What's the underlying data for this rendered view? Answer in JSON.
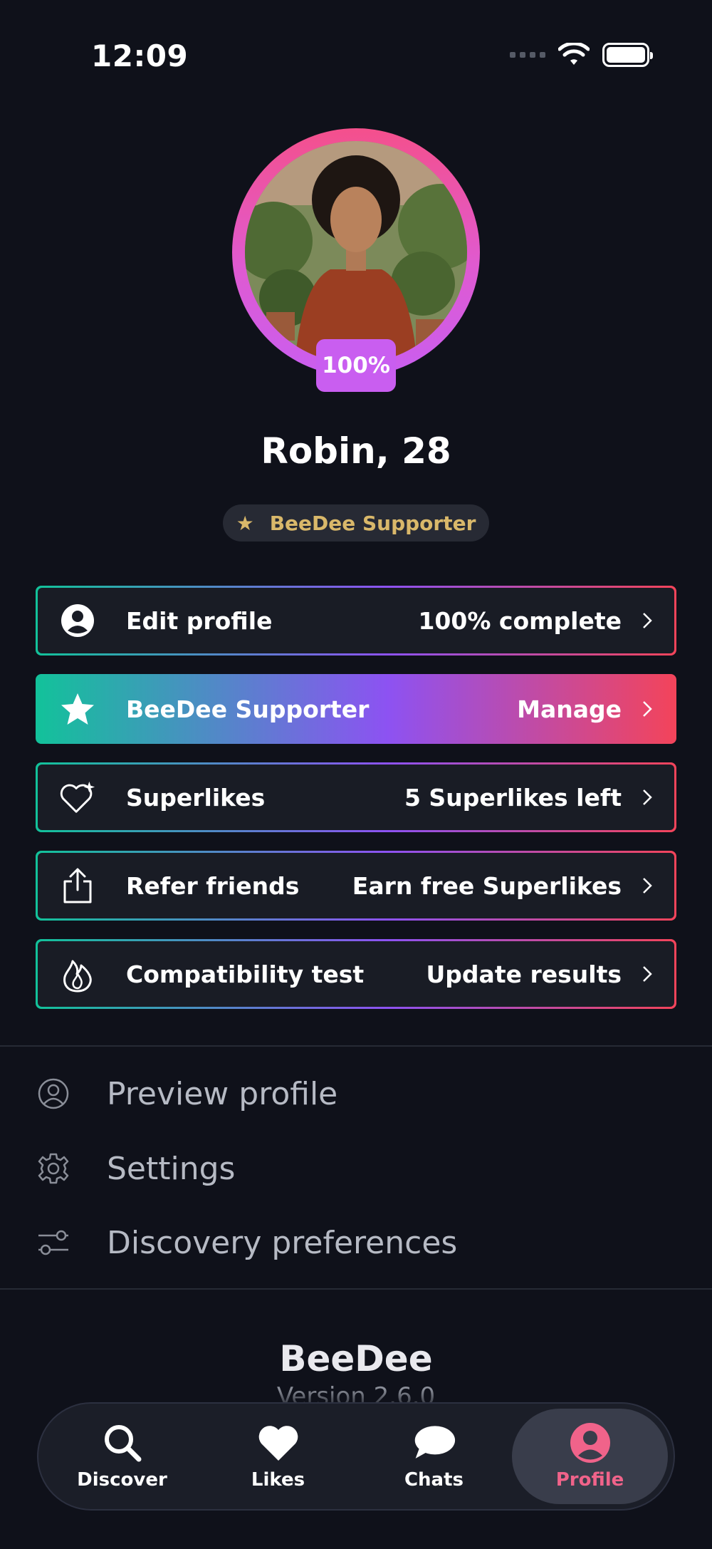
{
  "status_bar": {
    "time": "12:09"
  },
  "profile": {
    "completion_badge": "100%",
    "name": "Robin, 28",
    "supporter_badge": "BeeDee Supporter"
  },
  "cards": [
    {
      "icon": "user-circle-icon",
      "title": "Edit profile",
      "value": "100% complete"
    },
    {
      "icon": "star-icon",
      "title": "BeeDee Supporter",
      "value": "Manage"
    },
    {
      "icon": "heart-sparkle-icon",
      "title": "Superlikes",
      "value": "5 Superlikes left"
    },
    {
      "icon": "share-icon",
      "title": "Refer friends",
      "value": "Earn free Superlikes"
    },
    {
      "icon": "flame-icon",
      "title": "Compatibility test",
      "value": "Update results"
    }
  ],
  "plain_items": [
    {
      "icon": "user-outline-icon",
      "label": "Preview profile"
    },
    {
      "icon": "gear-icon",
      "label": "Settings"
    },
    {
      "icon": "sliders-icon",
      "label": "Discovery preferences"
    }
  ],
  "footer": {
    "app_name": "BeeDee",
    "version": "Version 2.6.0"
  },
  "nav": {
    "items": [
      {
        "icon": "search-icon",
        "label": "Discover"
      },
      {
        "icon": "heart-icon",
        "label": "Likes"
      },
      {
        "icon": "chat-bubble-icon",
        "label": "Chats"
      },
      {
        "icon": "profile-icon",
        "label": "Profile"
      }
    ],
    "active": "Profile"
  },
  "colors": {
    "background": "#0f111a",
    "accent_pink": "#f0638a",
    "badge_purple": "#c95ef0",
    "gold": "#d9b86a",
    "gradient_start": "#12c29a",
    "gradient_mid": "#8d52f2",
    "gradient_end": "#f3445a"
  }
}
